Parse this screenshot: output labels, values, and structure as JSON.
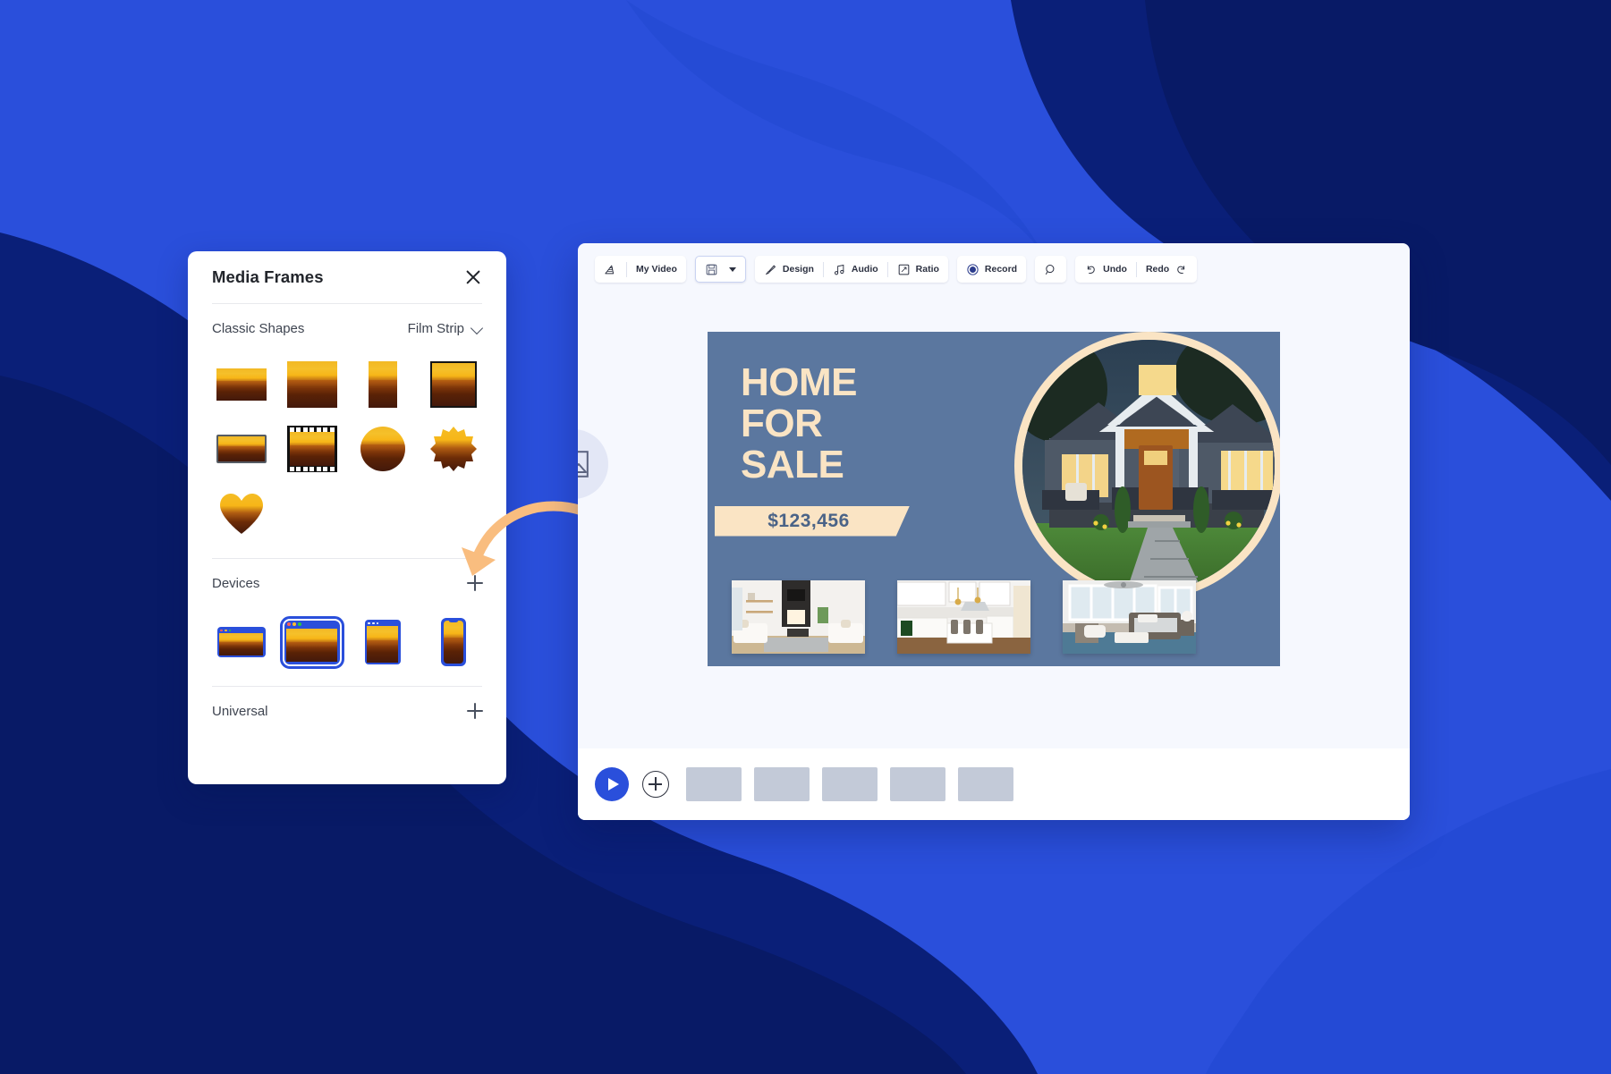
{
  "background": {
    "base_color": "#2a4fdb",
    "dark_color": "#0a1f78",
    "mid_color": "#1535b5",
    "light_color": "#3558e8"
  },
  "media_panel": {
    "title": "Media Frames",
    "close_icon": "close-icon",
    "sections": [
      {
        "name": "Classic Shapes",
        "dropdown_label": "Film Strip",
        "dropdown_icon": "chevron-down-icon",
        "frames": [
          {
            "name": "wide-rectangle-frame"
          },
          {
            "name": "square-frame"
          },
          {
            "name": "tall-portrait-frame"
          },
          {
            "name": "bordered-square-frame"
          },
          {
            "name": "tv-screen-frame"
          },
          {
            "name": "film-strip-frame"
          },
          {
            "name": "circle-frame"
          },
          {
            "name": "starburst-frame"
          },
          {
            "name": "heart-frame"
          }
        ]
      },
      {
        "name": "Devices",
        "add_icon": "plus-icon",
        "frames": [
          {
            "name": "browser-window-small-frame"
          },
          {
            "name": "browser-window-large-frame",
            "selected": true
          },
          {
            "name": "tablet-frame"
          },
          {
            "name": "phone-frame"
          }
        ]
      },
      {
        "name": "Universal",
        "add_icon": "plus-icon"
      }
    ]
  },
  "editor": {
    "toolbar": {
      "logo_icon": "app-logo-icon",
      "project_name": "My Video",
      "save_icon": "save-disk-icon",
      "save_caret_icon": "chevron-down-icon",
      "design_label": "Design",
      "design_icon": "brush-icon",
      "audio_label": "Audio",
      "audio_icon": "music-note-icon",
      "ratio_label": "Ratio",
      "ratio_icon": "crop-ratio-icon",
      "record_label": "Record",
      "record_icon": "record-dot-icon",
      "search_icon": "search-icon",
      "undo_label": "Undo",
      "undo_icon": "undo-arrow-icon",
      "redo_label": "Redo",
      "redo_icon": "redo-arrow-icon"
    },
    "canvas": {
      "background_color": "#5b779f",
      "accent_color": "#fae4c4",
      "headline_line1": "HOME",
      "headline_line2": "FOR",
      "headline_line3": "SALE",
      "price": "$123,456",
      "hero_image_alt": "craftsman-house-exterior-at-dusk",
      "thumbnails": [
        {
          "name": "living-room-thumbnail"
        },
        {
          "name": "kitchen-thumbnail"
        },
        {
          "name": "bedroom-thumbnail"
        }
      ],
      "drop_placeholder_icon": "image-placeholder-icon"
    },
    "timeline": {
      "play_icon": "play-icon",
      "add_clip_icon": "plus-circle-icon",
      "clips": [
        {
          "name": "timeline-clip-1"
        },
        {
          "name": "timeline-clip-2"
        },
        {
          "name": "timeline-clip-3"
        },
        {
          "name": "timeline-clip-4"
        },
        {
          "name": "timeline-clip-5"
        }
      ]
    }
  },
  "annotation": {
    "arrow_icon": "curved-arrow-icon",
    "arrow_color": "#f9bd7f"
  }
}
